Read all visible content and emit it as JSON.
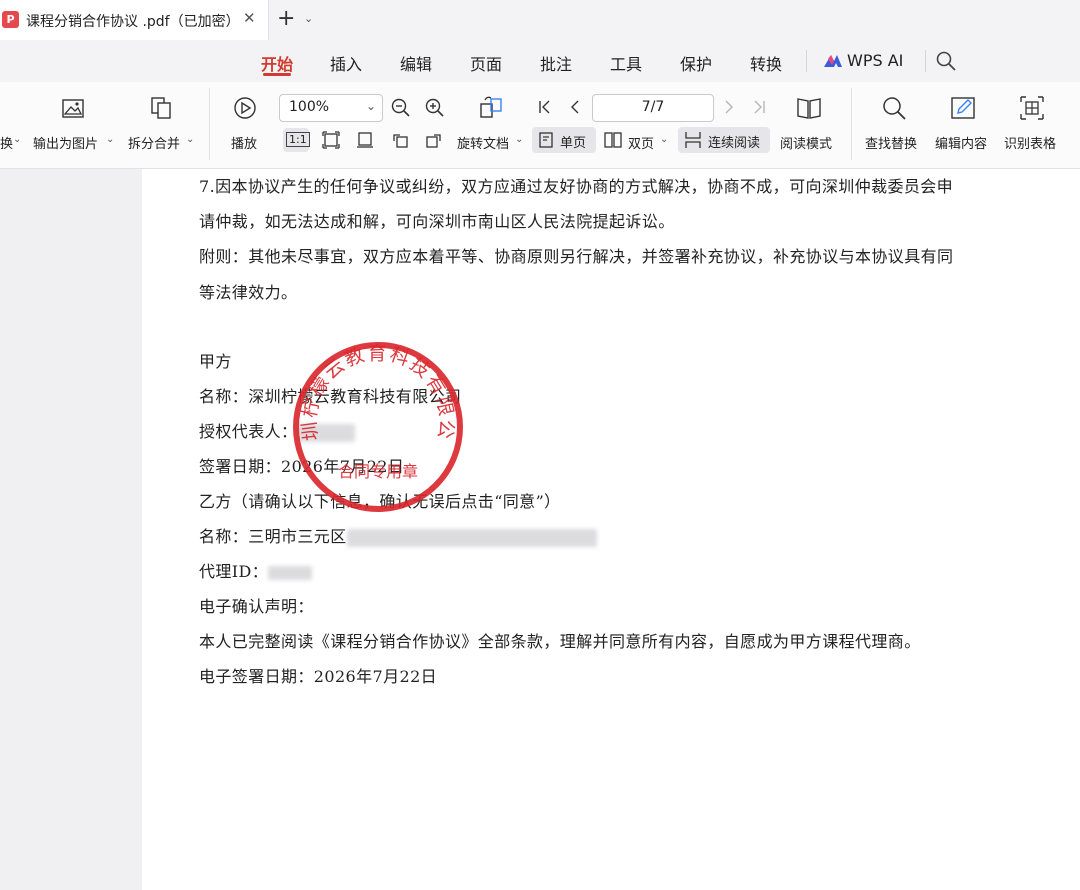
{
  "tabbar": {
    "doc_title": "课程分销合作协议 .pdf（已加密）",
    "close_glyph": "✕",
    "new_tab_glyph": "+",
    "new_tab_arrow": "⌄",
    "pdf_icon_letter": "P"
  },
  "menu": {
    "items": [
      "开始",
      "插入",
      "编辑",
      "页面",
      "批注",
      "工具",
      "保护",
      "转换",
      "WPS AI"
    ],
    "active": "开始"
  },
  "ribbon": {
    "convert_label": "换",
    "export_image_label": "输出为图片",
    "split_merge_label": "拆分合并",
    "play_label": "播放",
    "zoom_value": "100%",
    "zoom_arrow": "⌄",
    "actual_size_label": "1:1",
    "rotate_doc_label": "旋转文档",
    "page_value": "7/7",
    "single_page_label": "单页",
    "double_page_label": "双页",
    "continuous_label": "连续阅读",
    "read_mode_label": "阅读模式",
    "find_replace_label": "查找替换",
    "edit_content_label": "编辑内容",
    "recognize_table_label": "识别表格",
    "dropdown_glyph": "⌄"
  },
  "document": {
    "lines": [
      "7.因本协议产生的任何争议或纠纷，双方应通过友好协商的方式解决，协商不成，可向深圳仲裁委员会申",
      "请仲裁，如无法达成和解，可向深圳市南山区人民法院提起诉讼。",
      "附则：其他未尽事宜，双方应本着平等、协商原则另行解决，并签署补充协议，补充协议与本协议具有同",
      "等法律效力。",
      "甲方",
      "名称：深圳柠檬云教育科技有限公司",
      "授权代表人：",
      "签署日期：2026年7月22日",
      "乙方（请确认以下信息，确认无误后点击“同意”）",
      "名称：三明市三元区",
      "代理ID：",
      "电子确认声明：",
      "本人已完整阅读《课程分销合作协议》全部条款，理解并同意所有内容，自愿成为甲方课程代理商。",
      "电子签署日期：2026年7月22日"
    ],
    "stamp": {
      "top_text": "深圳柠檬云教育科技有限公司",
      "bottom_text": "合同专用章",
      "color": "#d9252b"
    }
  },
  "colors": {
    "accent": "#d23a2e",
    "stamp_red": "#d9252b"
  }
}
